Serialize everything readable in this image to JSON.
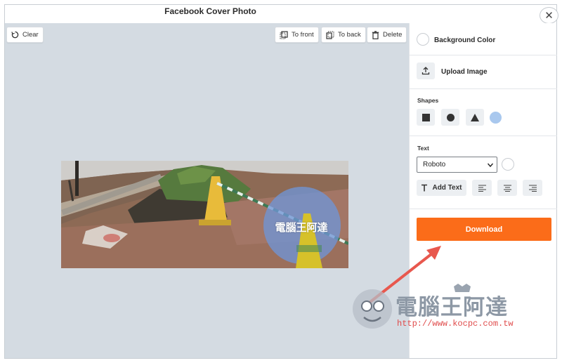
{
  "window": {
    "title": "Facebook Cover Photo",
    "close_symbol": "✕"
  },
  "toolbar": {
    "clear_label": "Clear",
    "to_front_label": "To front",
    "to_back_label": "To back",
    "delete_label": "Delete"
  },
  "canvas": {
    "background_color": "#d4dbe2",
    "overlay_text": "電腦王阿達",
    "overlay_circle_color": "#6f95d6"
  },
  "sidebar": {
    "background_color_label": "Background Color",
    "upload_image_label": "Upload Image",
    "shapes_label": "Shapes",
    "shapes": [
      "square-icon",
      "circle-icon",
      "triangle-icon"
    ],
    "shape_color": "#a9c8ee",
    "text_label": "Text",
    "font_select_value": "Roboto",
    "add_text_label": "Add Text",
    "align_buttons": [
      "align-left-icon",
      "align-center-icon",
      "align-right-icon"
    ],
    "download_label": "Download",
    "download_color": "#fb6c19"
  },
  "watermark": {
    "name": "電腦王阿達",
    "url": "http://www.kocpc.com.tw"
  }
}
